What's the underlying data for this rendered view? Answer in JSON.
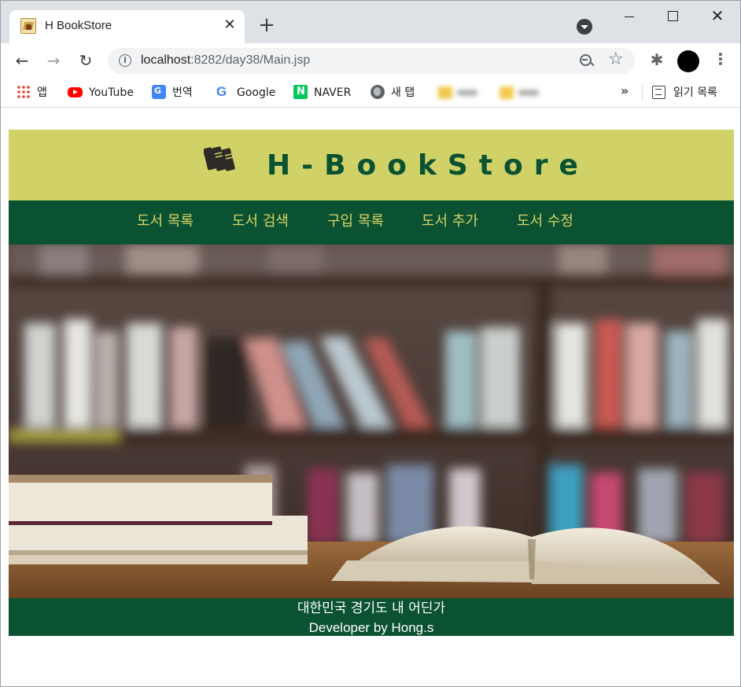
{
  "browser": {
    "tab_title": "H BookStore",
    "tab_close": "✕",
    "new_tab": "+",
    "url_host": "localhost",
    "url_path": ":8282/day38/Main.jsp",
    "window_close": "✕",
    "menu": "⋮",
    "back": "←",
    "forward": "→",
    "reload": "↻",
    "star": "☆",
    "extensions": "✱"
  },
  "bookmarks": {
    "items": [
      {
        "label": "앱",
        "icon": "apps-icon"
      },
      {
        "label": "YouTube",
        "icon": "youtube-icon"
      },
      {
        "label": "번역",
        "icon": "translate-icon"
      },
      {
        "label": "Google",
        "icon": "google-icon"
      },
      {
        "label": "NAVER",
        "icon": "naver-icon"
      },
      {
        "label": "새 탭",
        "icon": "globe-icon"
      }
    ],
    "more": "»",
    "reading_list": "읽기 목록"
  },
  "site": {
    "title": "H-BookStore",
    "nav": [
      "도서 목록",
      "도서 검색",
      "구입 목록",
      "도서 추가",
      "도서 수정"
    ],
    "footer_line1": "대한민국 경기도 내 어딘가",
    "footer_line2": "Developer by Hong.s",
    "colors": {
      "header_bg": "#d0d268",
      "brand_green": "#0b5232",
      "nav_text": "#d6d467"
    }
  }
}
